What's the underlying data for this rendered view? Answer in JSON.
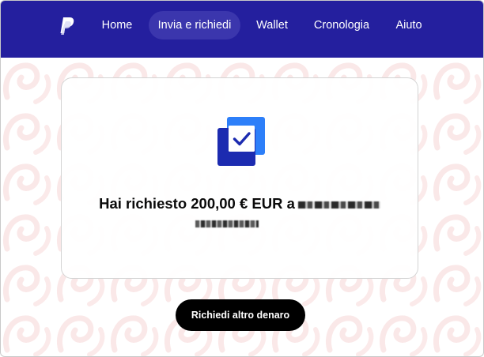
{
  "nav": {
    "logo_icon": "paypal-logo",
    "items": [
      {
        "label": "Home",
        "active": false
      },
      {
        "label": "Invia e richiedi",
        "active": true
      },
      {
        "label": "Wallet",
        "active": false
      },
      {
        "label": "Cronologia",
        "active": false
      },
      {
        "label": "Aiuto",
        "active": false
      }
    ]
  },
  "confirmation": {
    "icon": "checkbox-confirmed-icon",
    "message_prefix": "Hai richiesto 200,00 € EUR a",
    "recipient_redacted": true
  },
  "actions": {
    "request_more_label": "Richiedi altro denaro"
  },
  "colors": {
    "nav_background": "#241f9e",
    "nav_active": "#3b36ad",
    "icon_dark": "#1c2bb0",
    "icon_light": "#2d7ff9",
    "button_background": "#000000"
  }
}
